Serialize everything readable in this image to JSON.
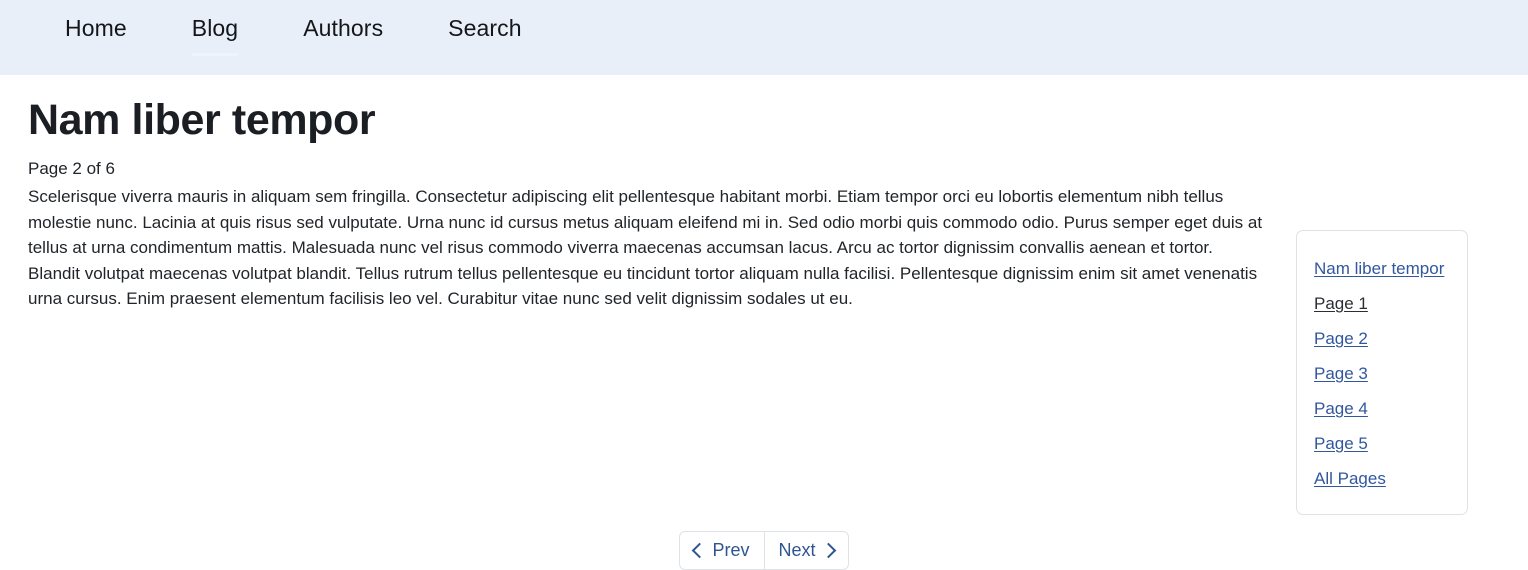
{
  "navbar": {
    "items": [
      {
        "label": "Home",
        "active": false
      },
      {
        "label": "Blog",
        "active": true
      },
      {
        "label": "Authors",
        "active": false
      },
      {
        "label": "Search",
        "active": false
      }
    ]
  },
  "article": {
    "title": "Nam liber tempor",
    "page_counter": "Page 2 of 6",
    "body": "Scelerisque viverra mauris in aliquam sem fringilla. Consectetur adipiscing elit pellentesque habitant morbi. Etiam tempor orci eu lobortis elementum nibh tellus molestie nunc. Lacinia at quis risus sed vulputate. Urna nunc id cursus metus aliquam eleifend mi in. Sed odio morbi quis commodo odio. Purus semper eget duis at tellus at urna condimentum mattis. Malesuada nunc vel risus commodo viverra maecenas accumsan lacus. Arcu ac tortor dignissim convallis aenean et tortor. Blandit volutpat maecenas volutpat blandit. Tellus rutrum tellus pellentesque eu tincidunt tortor aliquam nulla facilisi. Pellentesque dignissim enim sit amet venenatis urna cursus. Enim praesent elementum facilisis leo vel. Curabitur vitae nunc sed velit dignissim sodales ut eu."
  },
  "sidebar": {
    "links": [
      {
        "label": "Nam liber tempor",
        "visited": false
      },
      {
        "label": "Page 1",
        "visited": true
      },
      {
        "label": "Page 2",
        "visited": false
      },
      {
        "label": "Page 3",
        "visited": false
      },
      {
        "label": "Page 4",
        "visited": false
      },
      {
        "label": "Page 5",
        "visited": false
      },
      {
        "label": "All Pages",
        "visited": false
      }
    ]
  },
  "pager": {
    "prev_label": "Prev",
    "next_label": "Next"
  },
  "colors": {
    "navbar_bg": "#e9eff8",
    "link": "#31579e",
    "visited_link": "#2b2f33",
    "text": "#212529",
    "border": "#dee2e6",
    "pager_text": "#2e558f"
  }
}
